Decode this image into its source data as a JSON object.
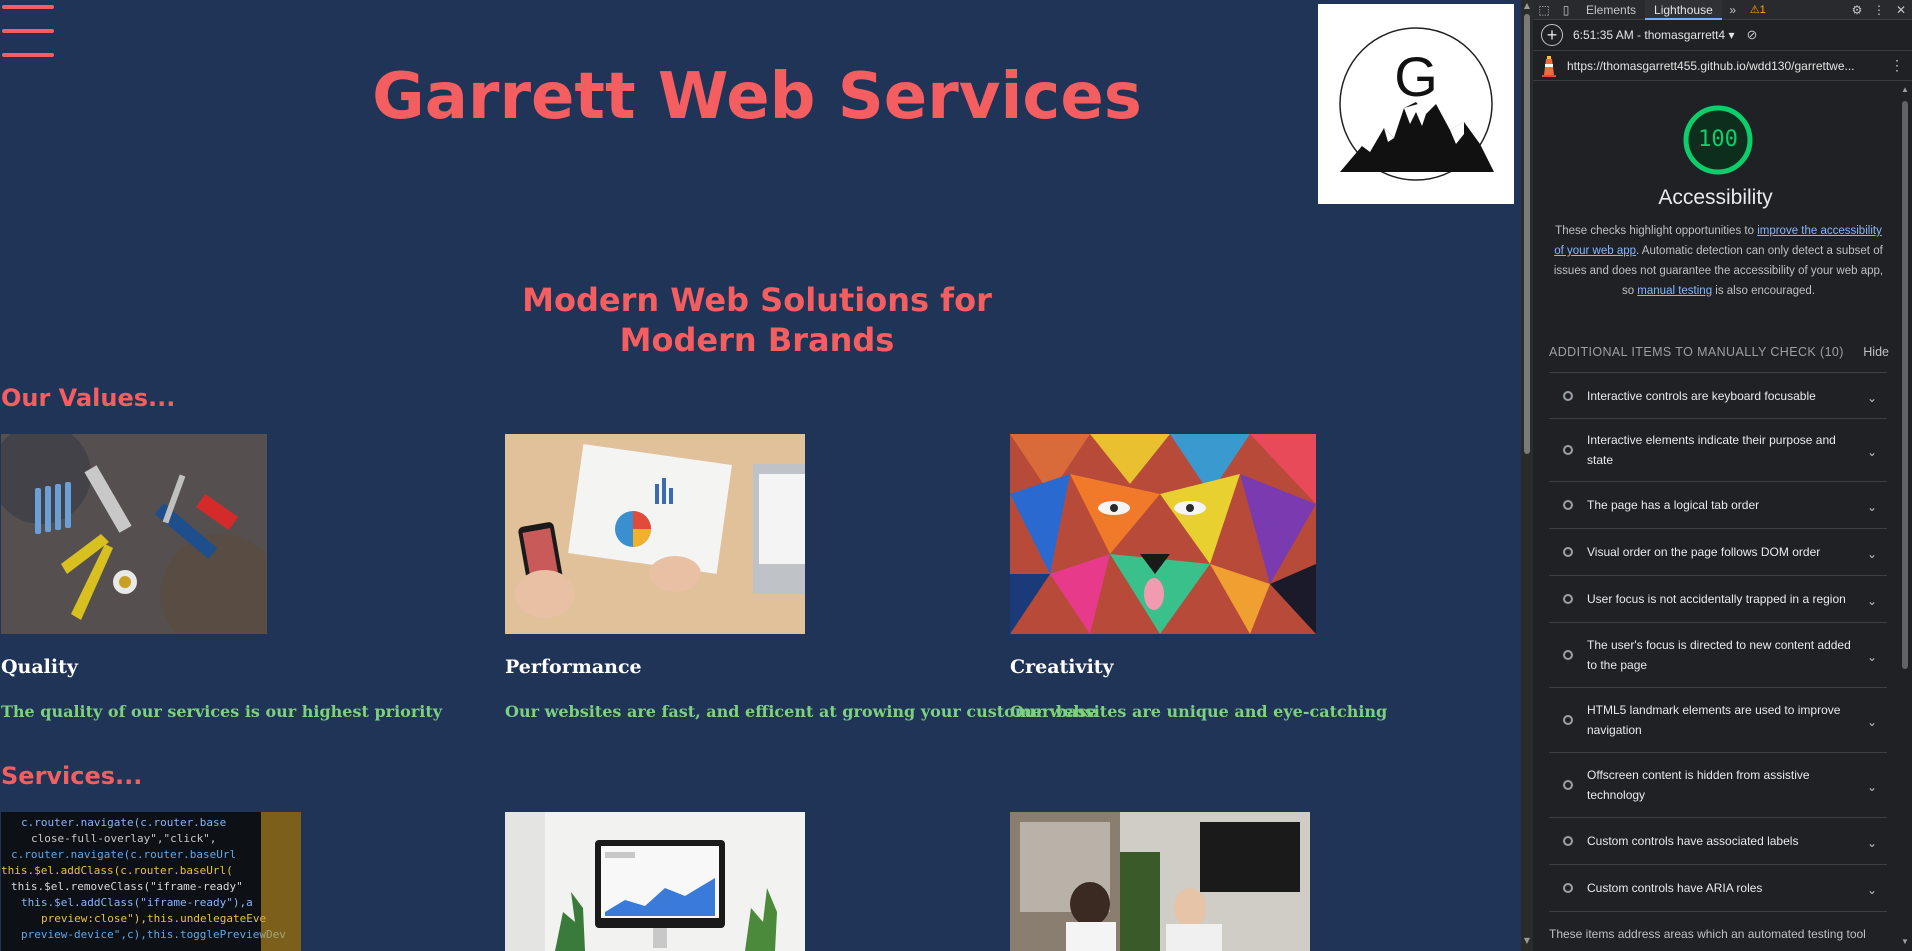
{
  "site": {
    "title": "Garrett Web Services",
    "logo_letter": "G",
    "tagline_line1": "Modern Web Solutions for",
    "tagline_line2": "Modern Brands",
    "values_heading": "Our Values...",
    "services_heading": "Services...",
    "values": [
      {
        "title": "Quality",
        "text": "The quality of our services is our highest priority"
      },
      {
        "title": "Performance",
        "text": "Our websites are fast, and efficent at growing your customer base"
      },
      {
        "title": "Creativity",
        "text": "Our websites are unique and eye-catching"
      }
    ],
    "code_lines": [
      "c.router.navigate(c.router.base",
      "close-full-overlay\",\"click\",",
      "c.router.navigate(c.router.baseUrl",
      "this.$el.addClass(c.router.baseUrl(",
      "this.$el.removeClass(\"iframe-ready\"",
      "this.$el.addClass(\"iframe-ready\"),a",
      "preview:close\"),this.undelegateEve",
      "preview-device\",c),this.togglePreviewDev"
    ]
  },
  "devtools": {
    "tabs": [
      "Elements",
      "Lighthouse"
    ],
    "warning_count": "1",
    "report_selector": "6:51:35 AM - thomasgarrett4",
    "url": "https://thomasgarrett455.github.io/wdd130/garrettwe...",
    "score": "100",
    "category": "Accessibility",
    "desc_before": "These checks highlight opportunities to ",
    "desc_link1": "improve the accessibility of your web app",
    "desc_middle": ". Automatic detection can only detect a subset of issues and does not guarantee the accessibility of your web app, so ",
    "desc_link2": "manual testing",
    "desc_after": " is also encouraged.",
    "manual_heading": "ADDITIONAL ITEMS TO MANUALLY CHECK (10)",
    "hide_label": "Hide",
    "audits": [
      "Interactive controls are keyboard focusable",
      "Interactive elements indicate their purpose and state",
      "The page has a logical tab order",
      "Visual order on the page follows DOM order",
      "User focus is not accidentally trapped in a region",
      "The user's focus is directed to new content added to the page",
      "HTML5 landmark elements are used to improve navigation",
      "Offscreen content is hidden from assistive technology",
      "Custom controls have associated labels",
      "Custom controls have ARIA roles"
    ],
    "footer_text": "These items address areas which an automated testing tool"
  },
  "colors": {
    "background": "#1f3456",
    "accent": "#f45e61",
    "green_text": "#7ecf82",
    "score_green": "#0cce6b",
    "link": "#8ab4f8"
  }
}
